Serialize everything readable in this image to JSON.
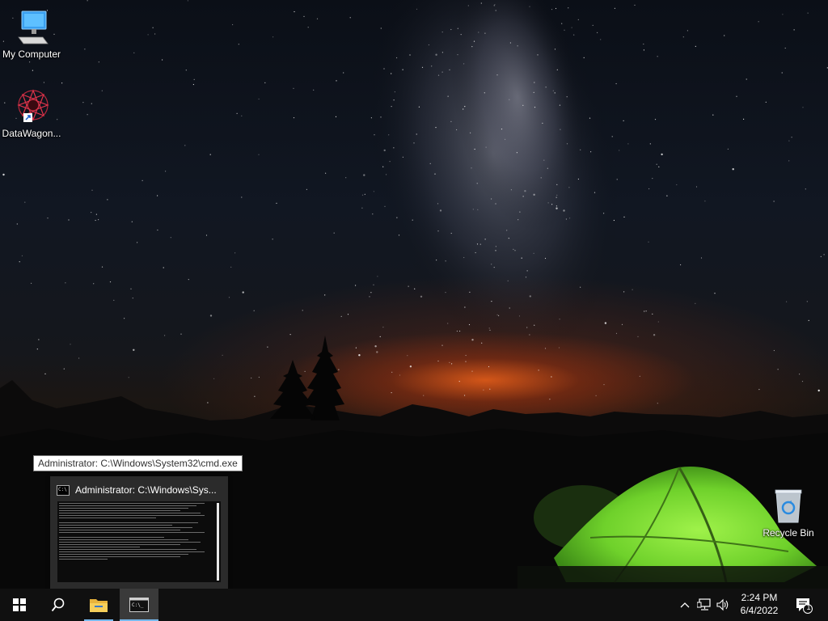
{
  "desktop": {
    "icons": [
      {
        "label": "My Computer",
        "icon": "computer-icon"
      },
      {
        "label": "DataWagon...",
        "icon": "datawagon-shortcut-icon"
      },
      {
        "label": "Recycle Bin",
        "icon": "recycle-bin-icon"
      }
    ]
  },
  "taskbar_preview": {
    "tooltip": "Administrator: C:\\Windows\\System32\\cmd.exe",
    "window_title": "Administrator: C:\\Windows\\Sys..."
  },
  "taskbar": {
    "buttons": [
      "start-icon",
      "search-icon",
      "file-explorer-icon",
      "cmd-icon"
    ],
    "tray": [
      "chevron-up-icon",
      "network-icon",
      "volume-icon"
    ],
    "time": "2:24 PM",
    "date": "6/4/2022",
    "notification_count": "1"
  },
  "colors": {
    "taskbar": "#101010",
    "active_indicator": "#76b9ed",
    "tent_green": "#7ee23a",
    "sunset_glow": "#e45c1b"
  }
}
